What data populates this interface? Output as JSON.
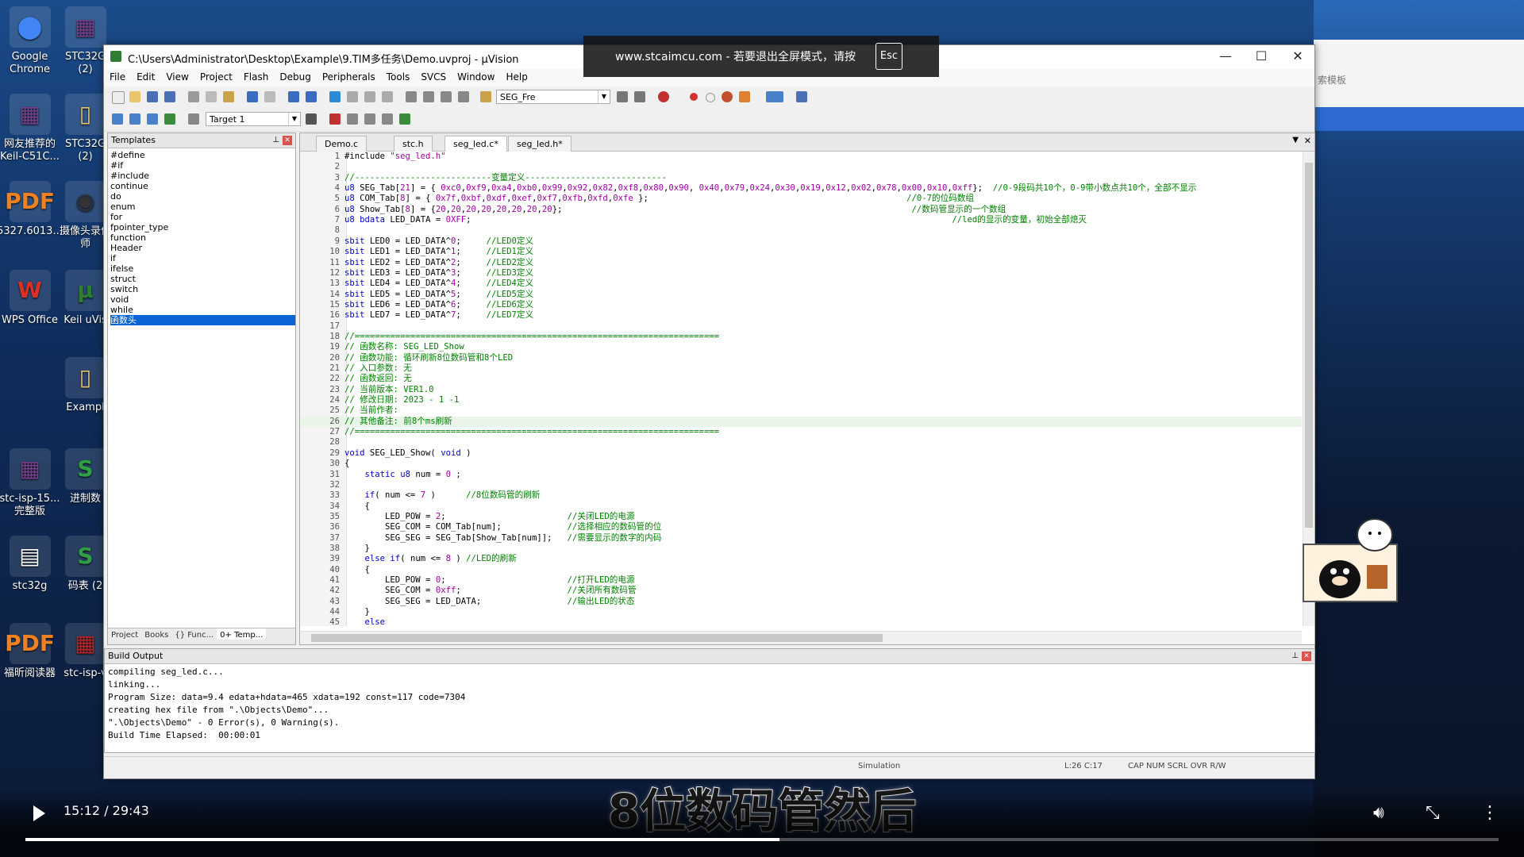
{
  "desktop": {
    "icons_left": [
      {
        "label": "Google\nChrome",
        "glyph": "⬤",
        "color": "#4285f4"
      },
      {
        "label": "网友推荐的\nKeil-C51C...",
        "glyph": "▦",
        "color": "#7a3b8c"
      },
      {
        "label": "5327.6013...",
        "glyph": "PDF",
        "color": "#f08020"
      },
      {
        "label": "WPS Office",
        "glyph": "W",
        "color": "#d93025"
      },
      {
        "label": "stc-isp-15...\n完整版",
        "glyph": "▦",
        "color": "#7a3b8c"
      },
      {
        "label": "stc32g",
        "glyph": "▤",
        "color": "#ffffff"
      },
      {
        "label": "福昕阅读器",
        "glyph": "PDF",
        "color": "#f08020"
      }
    ],
    "icons_right": [
      {
        "label": "STC32G\n(2)",
        "glyph": "▦",
        "color": "#7a3b8c"
      },
      {
        "label": "STC32G\n(2)",
        "glyph": "▯",
        "color": "#e8c56a"
      },
      {
        "label": "摄像头录像\n师",
        "glyph": "◉",
        "color": "#333333"
      },
      {
        "label": "Keil uVis",
        "glyph": "µ",
        "color": "#2f7d32"
      },
      {
        "label": "Exampl",
        "glyph": "▯",
        "color": "#e8c56a"
      },
      {
        "label": "进制数",
        "glyph": "S",
        "color": "#2f9e44"
      },
      {
        "label": "码表 (2",
        "glyph": "S",
        "color": "#2f9e44"
      },
      {
        "label": "stc-isp-v",
        "glyph": "▦",
        "color": "#c02020"
      }
    ],
    "right_panel_text": "索模板"
  },
  "window": {
    "title": "C:\\Users\\Administrator\\Desktop\\Example\\9.TIM多任务\\Demo.uvproj - µVision",
    "controls": {
      "minimize": "—",
      "maximize": "☐",
      "close": "✕"
    }
  },
  "menu": [
    "File",
    "Edit",
    "View",
    "Project",
    "Flash",
    "Debug",
    "Peripherals",
    "Tools",
    "SVCS",
    "Window",
    "Help"
  ],
  "toolbar": {
    "find_combo": "SEG_Fre",
    "target_combo": "Target 1"
  },
  "templates": {
    "title": "Templates",
    "items": [
      "#define",
      "#if",
      "#include",
      "continue",
      "do",
      "enum",
      "for",
      "fpointer_type",
      "function",
      "Header",
      "if",
      "ifelse",
      "struct",
      "switch",
      "void",
      "while",
      "函数头"
    ],
    "selected": "函数头",
    "tabs": [
      "Project",
      "Books",
      "{} Func...",
      "0+ Temp..."
    ]
  },
  "editor": {
    "tabs": [
      "Demo.c",
      "stc.h",
      "seg_led.c*",
      "seg_led.h*"
    ],
    "active_tab": "seg_led.c*",
    "lines": [
      {
        "n": "1",
        "code": "#include \"seg_led.h\""
      },
      {
        "n": "2",
        "code": ""
      },
      {
        "n": "3",
        "code": "//---------------------------变量定义----------------------------"
      },
      {
        "n": "4",
        "code": "u8 SEG_Tab[21] = { 0xc0,0xf9,0xa4,0xb0,0x99,0x92,0x82,0xf8,0x80,0x90, 0x40,0x79,0x24,0x30,0x19,0x12,0x02,0x78,0x00,0x10,0xff};  //0-9段码共10个，0-9带小数点共10个，全部不显示"
      },
      {
        "n": "5",
        "code": "u8 COM_Tab[8] = { 0x7f,0xbf,0xdf,0xef,0xf7,0xfb,0xfd,0xfe };                                                   //0-7的位码数组"
      },
      {
        "n": "6",
        "code": "u8 Show_Tab[8] = {20,20,20,20,20,20,20,20};                                                                     //数码管显示的一个数组"
      },
      {
        "n": "7",
        "code": "u8 bdata LED_DATA = 0XFF;                                                                                               //led的显示的变量，初始全部熄灭"
      },
      {
        "n": "8",
        "code": ""
      },
      {
        "n": "9",
        "code": "sbit LED0 = LED_DATA^0;     //LED0定义"
      },
      {
        "n": "10",
        "code": "sbit LED1 = LED_DATA^1;     //LED1定义"
      },
      {
        "n": "11",
        "code": "sbit LED2 = LED_DATA^2;     //LED2定义"
      },
      {
        "n": "12",
        "code": "sbit LED3 = LED_DATA^3;     //LED3定义"
      },
      {
        "n": "13",
        "code": "sbit LED4 = LED_DATA^4;     //LED4定义"
      },
      {
        "n": "14",
        "code": "sbit LED5 = LED_DATA^5;     //LED5定义"
      },
      {
        "n": "15",
        "code": "sbit LED6 = LED_DATA^6;     //LED6定义"
      },
      {
        "n": "16",
        "code": "sbit LED7 = LED_DATA^7;     //LED7定义"
      },
      {
        "n": "17",
        "code": ""
      },
      {
        "n": "18",
        "code": "//========================================================================"
      },
      {
        "n": "19",
        "code": "// 函数名称: SEG_LED_Show"
      },
      {
        "n": "20",
        "code": "// 函数功能: 循环刷新8位数码管和8个LED"
      },
      {
        "n": "21",
        "code": "// 入口参数: 无"
      },
      {
        "n": "22",
        "code": "// 函数返回: 无"
      },
      {
        "n": "23",
        "code": "// 当前版本: VER1.0"
      },
      {
        "n": "24",
        "code": "// 修改日期: 2023 - 1 -1"
      },
      {
        "n": "25",
        "code": "// 当前作者:"
      },
      {
        "n": "26",
        "code": "// 其他备注: 前8个ms刷新"
      },
      {
        "n": "27",
        "code": "//========================================================================"
      },
      {
        "n": "28",
        "code": ""
      },
      {
        "n": "29",
        "code": "void SEG_LED_Show( void )"
      },
      {
        "n": "30",
        "code": "{"
      },
      {
        "n": "31",
        "code": "    static u8 num = 0 ;"
      },
      {
        "n": "32",
        "code": ""
      },
      {
        "n": "33",
        "code": "    if( num <= 7 )      //8位数码管的刷新"
      },
      {
        "n": "34",
        "code": "    {"
      },
      {
        "n": "35",
        "code": "        LED_POW = 2;                        //关闭LED的电源"
      },
      {
        "n": "36",
        "code": "        SEG_COM = COM_Tab[num];             //选择相应的数码管的位"
      },
      {
        "n": "37",
        "code": "        SEG_SEG = SEG_Tab[Show_Tab[num]];   //需要显示的数字的内码"
      },
      {
        "n": "38",
        "code": "    }"
      },
      {
        "n": "39",
        "code": "    else if( num <= 8 ) //LED的刷新"
      },
      {
        "n": "40",
        "code": "    {"
      },
      {
        "n": "41",
        "code": "        LED_POW = 0;                        //打开LED的电源"
      },
      {
        "n": "42",
        "code": "        SEG_COM = 0xff;                     //关闭所有数码管"
      },
      {
        "n": "43",
        "code": "        SEG_SEG = LED_DATA;                 //输出LED的状态"
      },
      {
        "n": "44",
        "code": "    }"
      },
      {
        "n": "45",
        "code": "    else"
      },
      {
        "n": "46",
        "code": "    {"
      }
    ],
    "highlight_line": "26"
  },
  "build": {
    "title": "Build Output",
    "lines": [
      "compiling seg_led.c...",
      "linking...",
      "Program Size: data=9.4 edata+hdata=465 xdata=192 const=117 code=7304",
      "creating hex file from \".\\Objects\\Demo\"...",
      "\".\\Objects\\Demo\" - 0 Error(s), 0 Warning(s).",
      "Build Time Elapsed:  00:00:01"
    ]
  },
  "status": {
    "mode": "Simulation",
    "pos": "L:26 C:17",
    "flags": "CAP  NUM  SCRL  OVR  R/W"
  },
  "overlay": {
    "text": "www.stcaimcu.com - 若要退出全屏模式，请按",
    "key": "Esc"
  },
  "subtitle": "8位数码管然后",
  "player": {
    "time": "15:12 / 29:43",
    "progress": 0.512
  }
}
